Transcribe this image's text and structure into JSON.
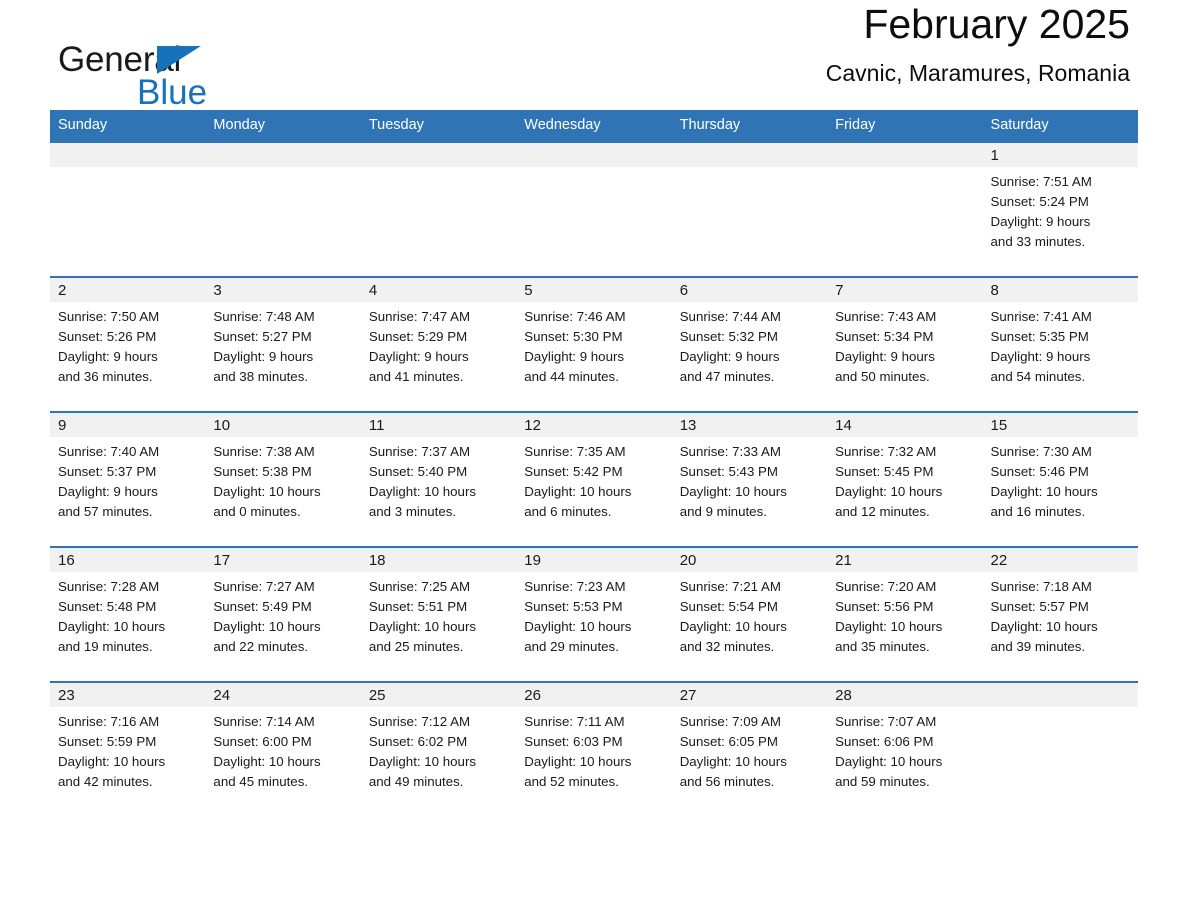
{
  "brand": {
    "name_part1": "General",
    "name_part2": "Blue",
    "triangle_color": "#1572bb",
    "icon": "triangle-logo-icon"
  },
  "header": {
    "title": "February 2025",
    "subtitle": "Cavnic, Maramures, Romania"
  },
  "theme": {
    "header_blue": "#2f75b5",
    "row_divider_blue": "#2f75b5",
    "daynum_band_gray": "#f1f1f1",
    "text_color": "#1a1a1a"
  },
  "weekday_headers": [
    "Sunday",
    "Monday",
    "Tuesday",
    "Wednesday",
    "Thursday",
    "Friday",
    "Saturday"
  ],
  "weeks": [
    [
      {
        "day": "",
        "blank": true
      },
      {
        "day": "",
        "blank": true
      },
      {
        "day": "",
        "blank": true
      },
      {
        "day": "",
        "blank": true
      },
      {
        "day": "",
        "blank": true
      },
      {
        "day": "",
        "blank": true
      },
      {
        "day": "1",
        "sunrise": "Sunrise: 7:51 AM",
        "sunset": "Sunset: 5:24 PM",
        "daylight_line1": "Daylight: 9 hours",
        "daylight_line2": "and 33 minutes."
      }
    ],
    [
      {
        "day": "2",
        "sunrise": "Sunrise: 7:50 AM",
        "sunset": "Sunset: 5:26 PM",
        "daylight_line1": "Daylight: 9 hours",
        "daylight_line2": "and 36 minutes."
      },
      {
        "day": "3",
        "sunrise": "Sunrise: 7:48 AM",
        "sunset": "Sunset: 5:27 PM",
        "daylight_line1": "Daylight: 9 hours",
        "daylight_line2": "and 38 minutes."
      },
      {
        "day": "4",
        "sunrise": "Sunrise: 7:47 AM",
        "sunset": "Sunset: 5:29 PM",
        "daylight_line1": "Daylight: 9 hours",
        "daylight_line2": "and 41 minutes."
      },
      {
        "day": "5",
        "sunrise": "Sunrise: 7:46 AM",
        "sunset": "Sunset: 5:30 PM",
        "daylight_line1": "Daylight: 9 hours",
        "daylight_line2": "and 44 minutes."
      },
      {
        "day": "6",
        "sunrise": "Sunrise: 7:44 AM",
        "sunset": "Sunset: 5:32 PM",
        "daylight_line1": "Daylight: 9 hours",
        "daylight_line2": "and 47 minutes."
      },
      {
        "day": "7",
        "sunrise": "Sunrise: 7:43 AM",
        "sunset": "Sunset: 5:34 PM",
        "daylight_line1": "Daylight: 9 hours",
        "daylight_line2": "and 50 minutes."
      },
      {
        "day": "8",
        "sunrise": "Sunrise: 7:41 AM",
        "sunset": "Sunset: 5:35 PM",
        "daylight_line1": "Daylight: 9 hours",
        "daylight_line2": "and 54 minutes."
      }
    ],
    [
      {
        "day": "9",
        "sunrise": "Sunrise: 7:40 AM",
        "sunset": "Sunset: 5:37 PM",
        "daylight_line1": "Daylight: 9 hours",
        "daylight_line2": "and 57 minutes."
      },
      {
        "day": "10",
        "sunrise": "Sunrise: 7:38 AM",
        "sunset": "Sunset: 5:38 PM",
        "daylight_line1": "Daylight: 10 hours",
        "daylight_line2": "and 0 minutes."
      },
      {
        "day": "11",
        "sunrise": "Sunrise: 7:37 AM",
        "sunset": "Sunset: 5:40 PM",
        "daylight_line1": "Daylight: 10 hours",
        "daylight_line2": "and 3 minutes."
      },
      {
        "day": "12",
        "sunrise": "Sunrise: 7:35 AM",
        "sunset": "Sunset: 5:42 PM",
        "daylight_line1": "Daylight: 10 hours",
        "daylight_line2": "and 6 minutes."
      },
      {
        "day": "13",
        "sunrise": "Sunrise: 7:33 AM",
        "sunset": "Sunset: 5:43 PM",
        "daylight_line1": "Daylight: 10 hours",
        "daylight_line2": "and 9 minutes."
      },
      {
        "day": "14",
        "sunrise": "Sunrise: 7:32 AM",
        "sunset": "Sunset: 5:45 PM",
        "daylight_line1": "Daylight: 10 hours",
        "daylight_line2": "and 12 minutes."
      },
      {
        "day": "15",
        "sunrise": "Sunrise: 7:30 AM",
        "sunset": "Sunset: 5:46 PM",
        "daylight_line1": "Daylight: 10 hours",
        "daylight_line2": "and 16 minutes."
      }
    ],
    [
      {
        "day": "16",
        "sunrise": "Sunrise: 7:28 AM",
        "sunset": "Sunset: 5:48 PM",
        "daylight_line1": "Daylight: 10 hours",
        "daylight_line2": "and 19 minutes."
      },
      {
        "day": "17",
        "sunrise": "Sunrise: 7:27 AM",
        "sunset": "Sunset: 5:49 PM",
        "daylight_line1": "Daylight: 10 hours",
        "daylight_line2": "and 22 minutes."
      },
      {
        "day": "18",
        "sunrise": "Sunrise: 7:25 AM",
        "sunset": "Sunset: 5:51 PM",
        "daylight_line1": "Daylight: 10 hours",
        "daylight_line2": "and 25 minutes."
      },
      {
        "day": "19",
        "sunrise": "Sunrise: 7:23 AM",
        "sunset": "Sunset: 5:53 PM",
        "daylight_line1": "Daylight: 10 hours",
        "daylight_line2": "and 29 minutes."
      },
      {
        "day": "20",
        "sunrise": "Sunrise: 7:21 AM",
        "sunset": "Sunset: 5:54 PM",
        "daylight_line1": "Daylight: 10 hours",
        "daylight_line2": "and 32 minutes."
      },
      {
        "day": "21",
        "sunrise": "Sunrise: 7:20 AM",
        "sunset": "Sunset: 5:56 PM",
        "daylight_line1": "Daylight: 10 hours",
        "daylight_line2": "and 35 minutes."
      },
      {
        "day": "22",
        "sunrise": "Sunrise: 7:18 AM",
        "sunset": "Sunset: 5:57 PM",
        "daylight_line1": "Daylight: 10 hours",
        "daylight_line2": "and 39 minutes."
      }
    ],
    [
      {
        "day": "23",
        "sunrise": "Sunrise: 7:16 AM",
        "sunset": "Sunset: 5:59 PM",
        "daylight_line1": "Daylight: 10 hours",
        "daylight_line2": "and 42 minutes."
      },
      {
        "day": "24",
        "sunrise": "Sunrise: 7:14 AM",
        "sunset": "Sunset: 6:00 PM",
        "daylight_line1": "Daylight: 10 hours",
        "daylight_line2": "and 45 minutes."
      },
      {
        "day": "25",
        "sunrise": "Sunrise: 7:12 AM",
        "sunset": "Sunset: 6:02 PM",
        "daylight_line1": "Daylight: 10 hours",
        "daylight_line2": "and 49 minutes."
      },
      {
        "day": "26",
        "sunrise": "Sunrise: 7:11 AM",
        "sunset": "Sunset: 6:03 PM",
        "daylight_line1": "Daylight: 10 hours",
        "daylight_line2": "and 52 minutes."
      },
      {
        "day": "27",
        "sunrise": "Sunrise: 7:09 AM",
        "sunset": "Sunset: 6:05 PM",
        "daylight_line1": "Daylight: 10 hours",
        "daylight_line2": "and 56 minutes."
      },
      {
        "day": "28",
        "sunrise": "Sunrise: 7:07 AM",
        "sunset": "Sunset: 6:06 PM",
        "daylight_line1": "Daylight: 10 hours",
        "daylight_line2": "and 59 minutes."
      },
      {
        "day": "",
        "blank": true
      }
    ]
  ]
}
